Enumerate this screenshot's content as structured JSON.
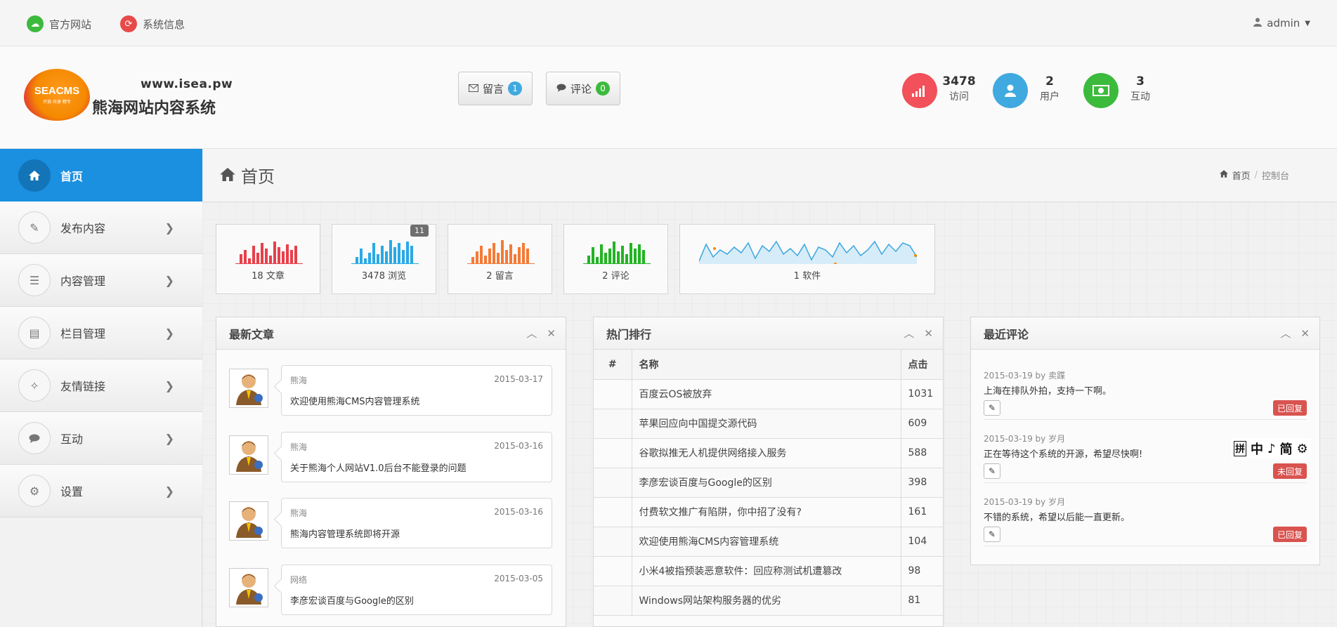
{
  "topbar": {
    "site_link": "官方网站",
    "sysinfo_link": "系统信息",
    "user": "admin"
  },
  "header": {
    "logo_text": "SEACMS",
    "logo_tagline": "开放·共享·精专",
    "site_url": "www.isea.pw",
    "site_name": "熊海网站内容系统",
    "msg_button": "留言",
    "msg_count": "1",
    "comment_button": "评论",
    "comment_count": "0",
    "stats": [
      {
        "value": "3478",
        "label": "访问",
        "color": "#f2505a"
      },
      {
        "value": "2",
        "label": "用户",
        "color": "#3fa9e0"
      },
      {
        "value": "3",
        "label": "互动",
        "color": "#3cba3c"
      }
    ]
  },
  "sidebar": {
    "items": [
      {
        "label": "首页",
        "icon": "home-icon"
      },
      {
        "label": "发布内容",
        "icon": "pencil-icon"
      },
      {
        "label": "内容管理",
        "icon": "list-icon"
      },
      {
        "label": "栏目管理",
        "icon": "columns-icon"
      },
      {
        "label": "友情链接",
        "icon": "magic-icon"
      },
      {
        "label": "互动",
        "icon": "comments-icon"
      },
      {
        "label": "设置",
        "icon": "gears-icon"
      }
    ]
  },
  "page": {
    "title": "首页",
    "breadcrumb_home": "首页",
    "breadcrumb_current": "控制台"
  },
  "tiles": [
    {
      "caption": "18 文章",
      "color": "#e8404a"
    },
    {
      "caption": "3478 浏览",
      "color": "#29a9e6",
      "badge": "11"
    },
    {
      "caption": "2 留言",
      "color": "#f57a36"
    },
    {
      "caption": "2 评论",
      "color": "#22b423"
    },
    {
      "caption": "1 软件",
      "color": "#3aa7dc"
    }
  ],
  "articles_panel": {
    "title": "最新文章",
    "items": [
      {
        "author": "熊海",
        "date": "2015-03-17",
        "title": "欢迎使用熊海CMS内容管理系统"
      },
      {
        "author": "熊海",
        "date": "2015-03-16",
        "title": "关于熊海个人网站V1.0后台不能登录的问题"
      },
      {
        "author": "熊海",
        "date": "2015-03-16",
        "title": "熊海内容管理系统即将开源"
      },
      {
        "author": "网络",
        "date": "2015-03-05",
        "title": "李彦宏谈百度与Google的区别"
      }
    ]
  },
  "hot_panel": {
    "title": "热门排行",
    "columns": [
      "#",
      "名称",
      "点击"
    ],
    "rows": [
      {
        "name": "百度云OS被放弃",
        "clicks": "1031"
      },
      {
        "name": "苹果回应向中国提交源代码",
        "clicks": "609"
      },
      {
        "name": "谷歌拟推无人机提供网络接入服务",
        "clicks": "588"
      },
      {
        "name": "李彦宏谈百度与Google的区别",
        "clicks": "398"
      },
      {
        "name": "付费软文推广有陷阱，你中招了没有?",
        "clicks": "161"
      },
      {
        "name": "欢迎使用熊海CMS内容管理系统",
        "clicks": "104"
      },
      {
        "name": "小米4被指预装恶意软件：回应称测试机遭篡改",
        "clicks": "98"
      },
      {
        "name": "Windows网站架构服务器的优劣",
        "clicks": "81"
      }
    ]
  },
  "comments_panel": {
    "title": "最近评论",
    "items": [
      {
        "meta": "2015-03-19 by 卖蹀",
        "text": "上海在排队外拍，支持一下啊。",
        "status": "已回复"
      },
      {
        "meta": "2015-03-19 by 岁月",
        "text": "正在等待这个系统的开源，希望尽快啊!",
        "status": "未回复"
      },
      {
        "meta": "2015-03-19 by 岁月",
        "text": "不错的系统，希望以后能一直更新。",
        "status": "已回复"
      }
    ]
  },
  "ime": {
    "items": [
      "拼",
      "中",
      "♪",
      "简",
      "⚙"
    ]
  }
}
